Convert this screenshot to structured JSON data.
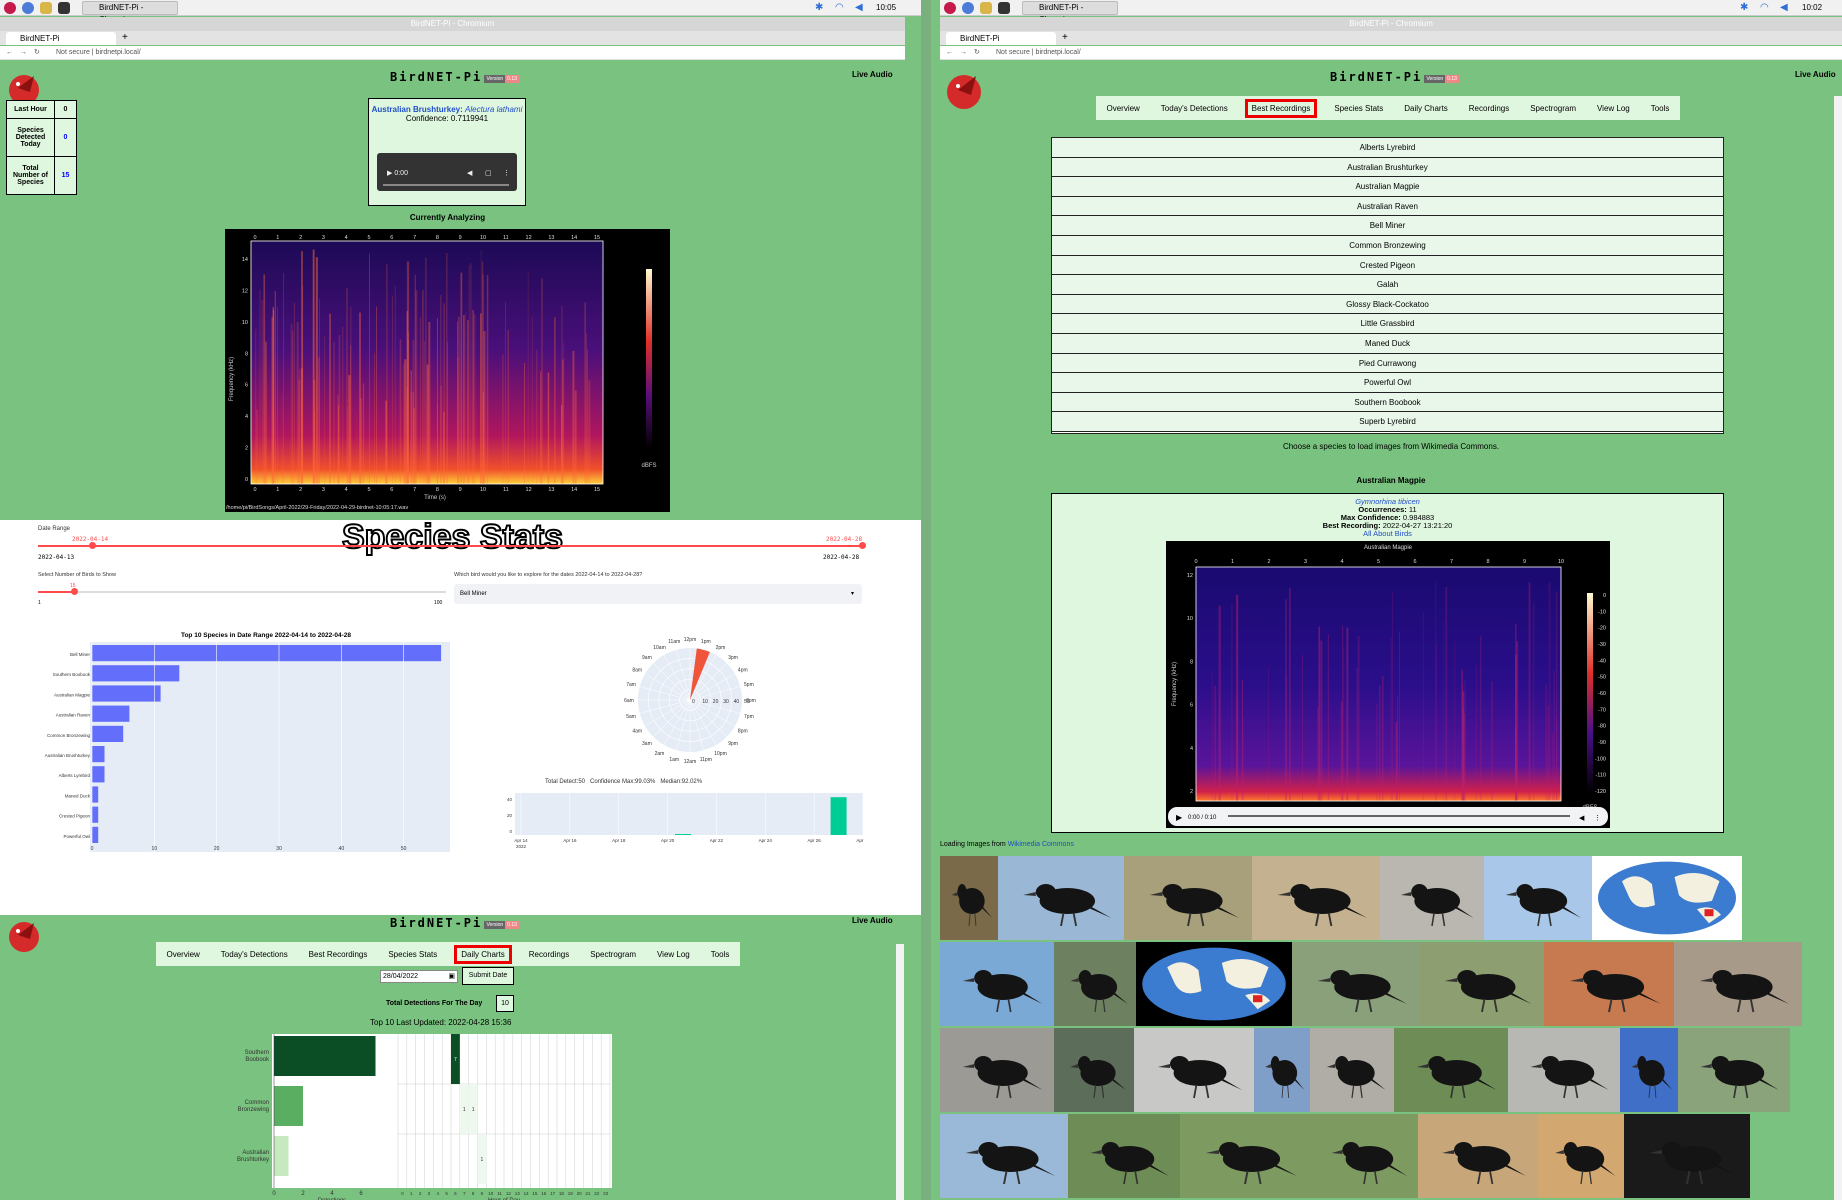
{
  "left_window": {
    "taskbar": {
      "task_label": "BirdNET-Pi - Chromiu...",
      "clock": "10:05"
    },
    "titlebar": "BirdNET-Pi - Chromium",
    "tab_title": "BirdNET-Pi",
    "url": "Not secure | birdnetpi.local/",
    "header": {
      "title": "BirdNET-Pi",
      "version_label": "Version",
      "version": "0.13",
      "live_audio": "Live Audio"
    },
    "stats": [
      {
        "label": "Last Hour",
        "value": "0"
      },
      {
        "label": "Species Detected Today",
        "value": "0"
      },
      {
        "label": "Total Number of Species",
        "value": "15"
      }
    ],
    "detection": {
      "name": "Australian Brushturkey:",
      "sci": "Alectura lathami",
      "confidence": "Confidence: 0.7119941",
      "audio_time": "0:00"
    },
    "currently_analyzing": "Currently Analyzing",
    "spectrogram_caption": "/home/pi/BirdSongs/April-2022/29-Friday/2022-04-29-birdnet-10:05:17.wav",
    "x_ticks": [
      "0",
      "1",
      "2",
      "3",
      "4",
      "5",
      "6",
      "7",
      "8",
      "9",
      "10",
      "11",
      "12",
      "13",
      "14",
      "15"
    ],
    "y_ticks": [
      "14",
      "12",
      "10",
      "8",
      "6",
      "4",
      "2",
      "0"
    ],
    "xlabel": "Time (s)",
    "ylabel": "Frequency (kHz)",
    "cbar_label": "dBFS"
  },
  "species_stats": {
    "title": "Species Stats",
    "date_range_label": "Date Range",
    "date_start_sel": "2022-04-14",
    "date_end_sel": "2022-04-28",
    "date_start": "2022-04-13",
    "date_end": "2022-04-28",
    "num_birds_label": "Select Number of Birds to Show",
    "num_birds_value": "15",
    "num_min": "1",
    "num_max": "100",
    "explore_label": "Which bird would you like to explore for the dates 2022-04-14 to 2022-04-28?",
    "explore_value": "Bell Miner",
    "bar_title": "Top 10 Species in Date Range 2022-04-14 to 2022-04-28",
    "polar_hours": [
      "12pm",
      "1pm",
      "2pm",
      "3pm",
      "4pm",
      "5pm",
      "6pm",
      "7pm",
      "8pm",
      "9pm",
      "10pm",
      "11pm",
      "12am",
      "1am",
      "2am",
      "3am",
      "4am",
      "5am",
      "6am",
      "7am",
      "8am",
      "9am",
      "10am",
      "11am"
    ],
    "polar_radial": [
      "0",
      "10",
      "20",
      "30",
      "40",
      "50"
    ],
    "summary": "Total Detect:50   Confidence Max:99.03%   Median:92.02%",
    "timeline_ticks": [
      "Apr 14\n2022",
      "Apr 16",
      "Apr 18",
      "Apr 20",
      "Apr 22",
      "Apr 24",
      "Apr 26",
      "Apr 28"
    ],
    "timeline_y": [
      "40",
      "20",
      "0"
    ]
  },
  "bottom_left": {
    "header": {
      "title": "BirdNET-Pi",
      "version_label": "Version",
      "version": "0.13",
      "live_audio": "Live Audio"
    },
    "nav": [
      "Overview",
      "Today's Detections",
      "Best Recordings",
      "Species Stats",
      "Daily Charts",
      "Recordings",
      "Spectrogram",
      "View Log",
      "Tools"
    ],
    "nav_selected": "Daily Charts",
    "date_value": "28/04/2022",
    "submit": "Submit Date",
    "total_label": "Total Detections For The Day",
    "total_value": "10",
    "top10": "Top 10 Last Updated: 2022-04-28 15:36",
    "xlabel": "Detections",
    "hour_label": "Hour of Day",
    "det_ticks": [
      "0",
      "2",
      "4",
      "6"
    ],
    "hour_ticks": [
      "0",
      "1",
      "2",
      "3",
      "4",
      "5",
      "6",
      "7",
      "8",
      "9",
      "10",
      "11",
      "12",
      "13",
      "14",
      "15",
      "16",
      "17",
      "18",
      "19",
      "20",
      "21",
      "22",
      "23"
    ],
    "cells": [
      "7",
      "1",
      "1",
      "1"
    ]
  },
  "right_window": {
    "taskbar": {
      "task_label": "BirdNET-Pi - Chromiu...",
      "clock": "10:02"
    },
    "titlebar": "BirdNET-Pi - Chromium",
    "tab_title": "BirdNET-Pi",
    "url": "Not secure | birdnetpi.local/",
    "header": {
      "title": "BirdNET-Pi",
      "version_label": "Version",
      "version": "0.13",
      "live_audio": "Live Audio"
    },
    "nav": [
      "Overview",
      "Today's Detections",
      "Best Recordings",
      "Species Stats",
      "Daily Charts",
      "Recordings",
      "Spectrogram",
      "View Log",
      "Tools"
    ],
    "nav_selected": "Best Recordings",
    "species": [
      "Alberts Lyrebird",
      "Australian Brushturkey",
      "Australian Magpie",
      "Australian Raven",
      "Bell Miner",
      "Common Bronzewing",
      "Crested Pigeon",
      "Galah",
      "Glossy Black-Cockatoo",
      "Little Grassbird",
      "Maned Duck",
      "Pied Currawong",
      "Powerful Owl",
      "Southern Boobook",
      "Superb Lyrebird"
    ],
    "choose_text": "Choose a species to load images from Wikimedia Commons.",
    "selected_species": "Australian Magpie",
    "sci_name": "Gymnorhina tibicen",
    "occ_label": "Occurrences:",
    "occ_value": "11",
    "maxconf_label": "Max Confidence:",
    "maxconf_value": "0.984883",
    "best_label": "Best Recording:",
    "best_value": "2022-04-27 13:21:20",
    "all_about": "All About Birds",
    "spec_title": "Australian Magpie",
    "audio_time": "0:00 / 0:10",
    "loading_text": "Loading Images from",
    "wikimedia": "Wikimedia Commons",
    "x_ticks": [
      "0",
      "1",
      "2",
      "3",
      "4",
      "5",
      "6",
      "7",
      "8",
      "9",
      "10"
    ],
    "y_ticks": [
      "12",
      "10",
      "8",
      "6",
      "4",
      "2"
    ],
    "cbar_ticks": [
      "0",
      "-10",
      "-20",
      "-30",
      "-40",
      "-50",
      "-60",
      "-70",
      "-80",
      "-90",
      "-100",
      "-110",
      "-120"
    ],
    "ylabel": "Frequency (kHz)",
    "cbar_label": "dBFS"
  },
  "chart_data": [
    {
      "type": "bar",
      "title": "Top 10 Species in Date Range 2022-04-14 to 2022-04-28",
      "orientation": "horizontal",
      "categories": [
        "Bell Miner",
        "Southern Boobook",
        "Australian Magpie",
        "Australian Raven",
        "Common Bronzewing",
        "Australian Brushturkey",
        "Alberts Lyrebird",
        "Maned Duck",
        "Crested Pigeon",
        "Powerful Owl"
      ],
      "values": [
        56,
        14,
        11,
        6,
        5,
        2,
        2,
        1,
        1,
        1
      ],
      "xlim": [
        0,
        60
      ],
      "x_ticks": [
        "0",
        "10",
        "20",
        "30",
        "40",
        "50"
      ],
      "color": "#636efa"
    },
    {
      "type": "bar",
      "title": "",
      "polar": true,
      "hours": [
        "1pm"
      ],
      "values": [
        50
      ],
      "rlim": [
        0,
        50
      ],
      "color": "#ef553b"
    },
    {
      "type": "bar",
      "title": "",
      "x": [
        "Apr 27"
      ],
      "values": [
        45
      ],
      "ylim": [
        0,
        50
      ],
      "color": "#00cc96"
    },
    {
      "type": "bar",
      "title": "",
      "orientation": "horizontal",
      "categories": [
        "Southern Boobook",
        "Common Bronzewing",
        "Australian Brushturkey"
      ],
      "values": [
        7,
        2,
        1
      ],
      "xlim": [
        0,
        8
      ],
      "colors": [
        "#0b4d25",
        "#5aae61",
        "#c7e9c0"
      ]
    },
    {
      "type": "heatmap",
      "title": "",
      "rows": [
        "Southern Boobook",
        "Common Bronzewing",
        "Australian Brushturkey"
      ],
      "hours": [
        6,
        7,
        8,
        9
      ],
      "cells": [
        {
          "row": 0,
          "hour": 6,
          "value": 7
        },
        {
          "row": 1,
          "hour": 7,
          "value": 1
        },
        {
          "row": 1,
          "hour": 8,
          "value": 1
        },
        {
          "row": 2,
          "hour": 9,
          "value": 1
        }
      ]
    }
  ]
}
